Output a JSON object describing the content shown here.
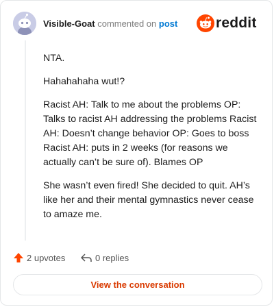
{
  "header": {
    "username": "Visible-Goat",
    "action_text": "commented on",
    "post_link": "post",
    "brand_name": "reddit"
  },
  "comment": {
    "paragraphs": [
      "NTA.",
      "Hahahahaha wut!?",
      "Racist AH: Talk to me about the problems OP: Talks to racist AH addressing the problems Racist AH: Doesn’t change behavior OP: Goes to boss Racist AH: puts in 2 weeks (for reasons we actually can’t be sure of). Blames OP",
      "She wasn’t even fired! She decided to quit. AH’s like her and their mental gymnastics never cease to amaze me."
    ]
  },
  "stats": {
    "upvotes": "2 upvotes",
    "replies": "0 replies"
  },
  "cta": {
    "label": "View the conversation"
  },
  "colors": {
    "brand_orange": "#ff4500",
    "link_blue": "#0079d3",
    "cta_text": "#d93a00",
    "avatar_bg": "#c9cce6"
  },
  "icons": {
    "avatar": "snoo-avatar",
    "brand": "reddit-logo-icon",
    "upvote": "upvote-arrow-icon",
    "reply": "reply-arrow-icon"
  }
}
